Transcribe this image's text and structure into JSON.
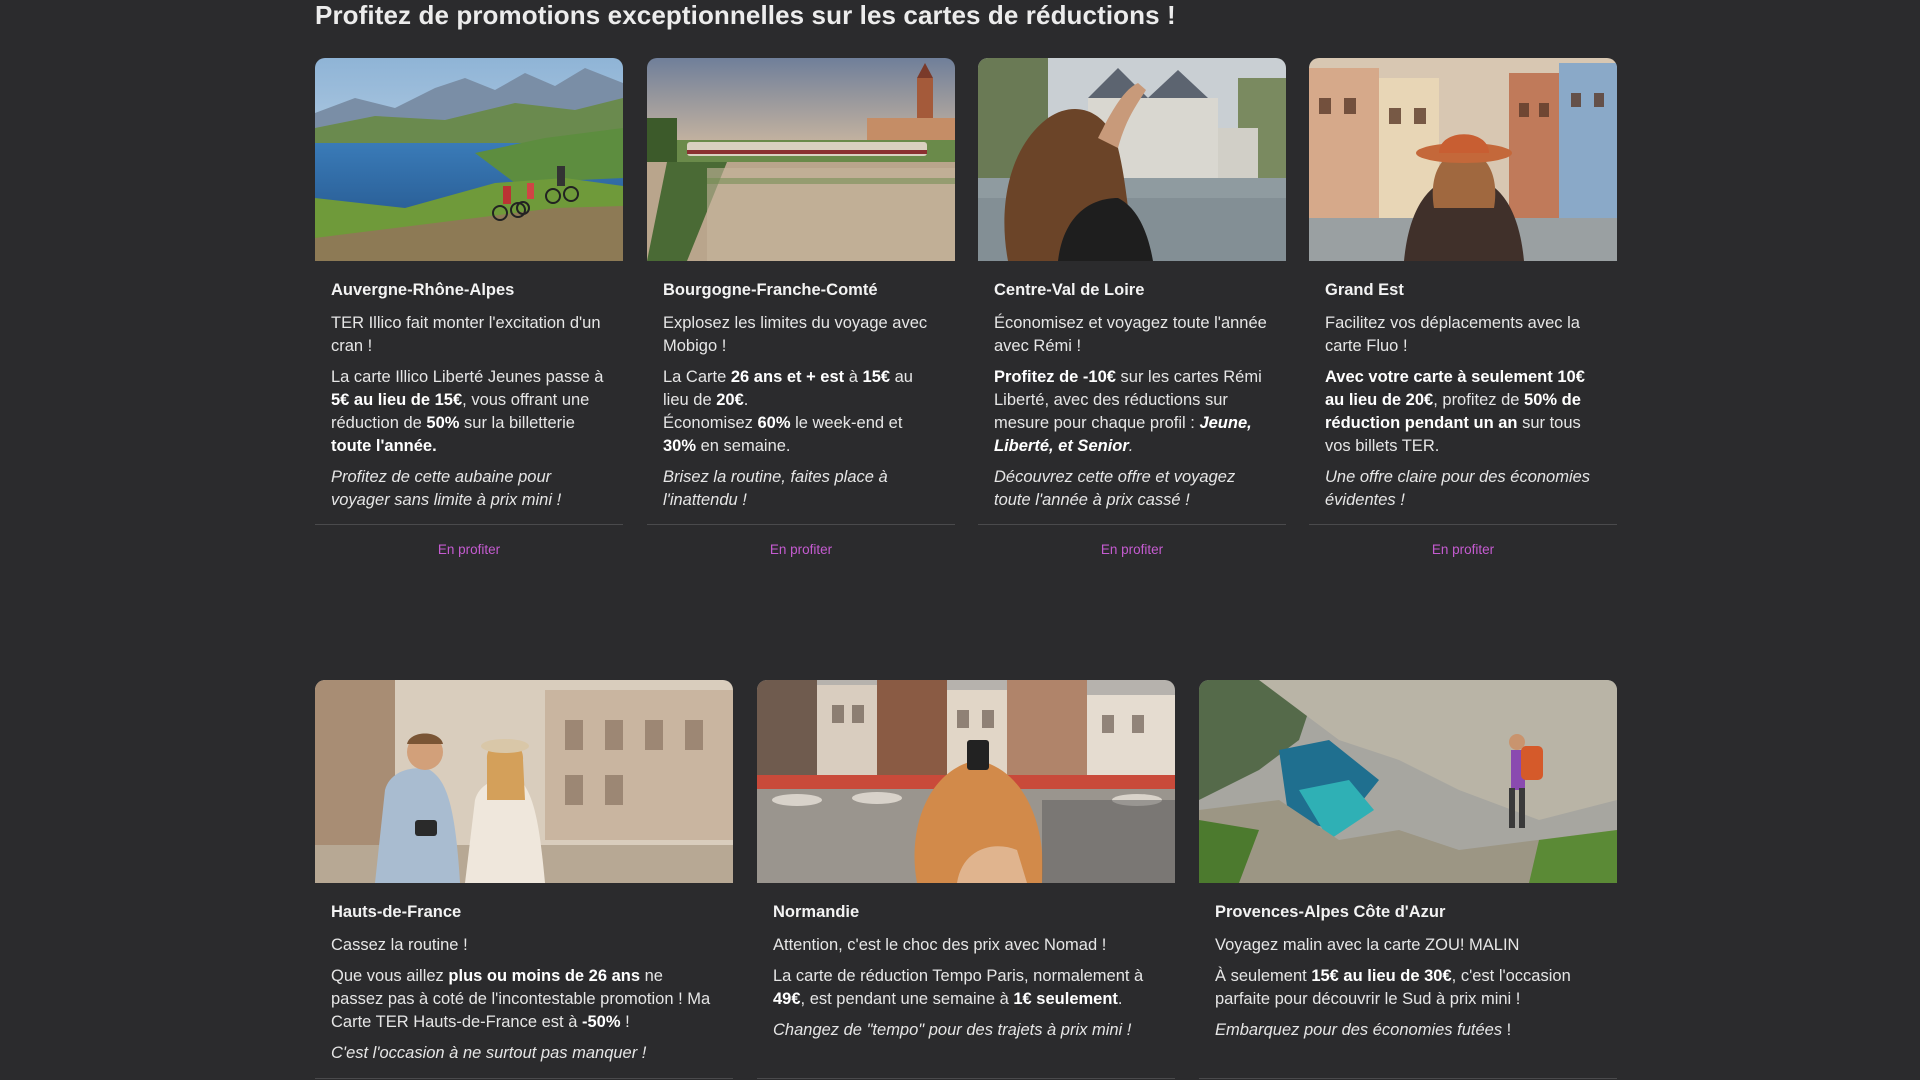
{
  "heading": "Profitez de promotions exceptionnelles sur les cartes de réductions !",
  "cta_label": "En profiter",
  "cards_row1": [
    {
      "region": "Auvergne-Rhône-Alpes",
      "tagline": "TER Illico fait monter l'excitation d'un cran !",
      "p1": "La carte Illico Liberté Jeunes passe à ",
      "p1b": "5€ au lieu de 15€",
      "p1c": ", vous offrant une réduction de ",
      "p1d": "50%",
      "p1e": " sur la billetterie ",
      "p1f": "toute l'année.",
      "closing": "Profitez de cette aubaine pour voyager sans limite à prix mini !"
    },
    {
      "region": "Bourgogne-Franche-Comté",
      "tagline": "Explosez les limites du voyage avec Mobigo !",
      "p1": "La Carte ",
      "p1b": "26 ans et + est",
      "p1c": " à ",
      "p1d": "15€",
      "p1e": " au lieu de ",
      "p1f": "20€",
      "p1g": ".",
      "p2": "Économisez ",
      "p2b": "60%",
      "p2c": " le week-end et ",
      "p2d": "30%",
      "p2e": " en semaine.",
      "closing": "Brisez la routine, faites place à l'inattendu !"
    },
    {
      "region": "Centre-Val de Loire",
      "tagline": "Économisez et voyagez toute l'année avec Rémi !",
      "p1b": "Profitez de -10€",
      "p1c": " sur les cartes Rémi Liberté, avec des réductions sur mesure pour chaque profil : ",
      "p1d": "Jeune, Liberté, et Senior",
      "p1e": ".",
      "closing": "Découvrez cette offre et voyagez toute l'année à prix cassé !"
    },
    {
      "region": "Grand Est",
      "tagline": "Facilitez vos déplacements avec la carte Fluo !",
      "p1b": "Avec votre carte à seulement 10€ au lieu de 20€",
      "p1c": ", profitez de ",
      "p1d": "50% de réduction pendant un an",
      "p1e": " sur tous vos billets TER.",
      "closing": "Une offre claire pour des économies évidentes !"
    }
  ],
  "cards_row2": [
    {
      "region": "Hauts-de-France",
      "tagline": "Cassez la routine !",
      "p1": "Que vous aillez ",
      "p1b": "plus ou moins de 26 ans",
      "p1c": " ne passez pas à coté de l'incontestable promotion ! Ma Carte TER Hauts-de-France est à ",
      "p1d": "-50%",
      "p1e": " !",
      "closing": "C'est l'occasion à ne surtout pas manquer !"
    },
    {
      "region": "Normandie",
      "tagline": "Attention, c'est le choc des prix avec Nomad !",
      "p1": "La carte de réduction Tempo Paris, normalement à ",
      "p1b": "49€",
      "p1c": ", est pendant une semaine à ",
      "p1d": "1€ seulement",
      "p1e": ".",
      "closing": "Changez de \"tempo\" pour des trajets à prix mini !"
    },
    {
      "region": "Provences-Alpes Côte d'Azur",
      "tagline": "Voyagez malin avec la carte ZOU! MALIN",
      "p1": "À seulement ",
      "p1b": "15€ au lieu de 30€",
      "p1c": ", c'est l'occasion parfaite pour découvrir le Sud à prix mini !",
      "closing": "Embarquez pour des économies futées",
      "closing_end": " !"
    }
  ]
}
